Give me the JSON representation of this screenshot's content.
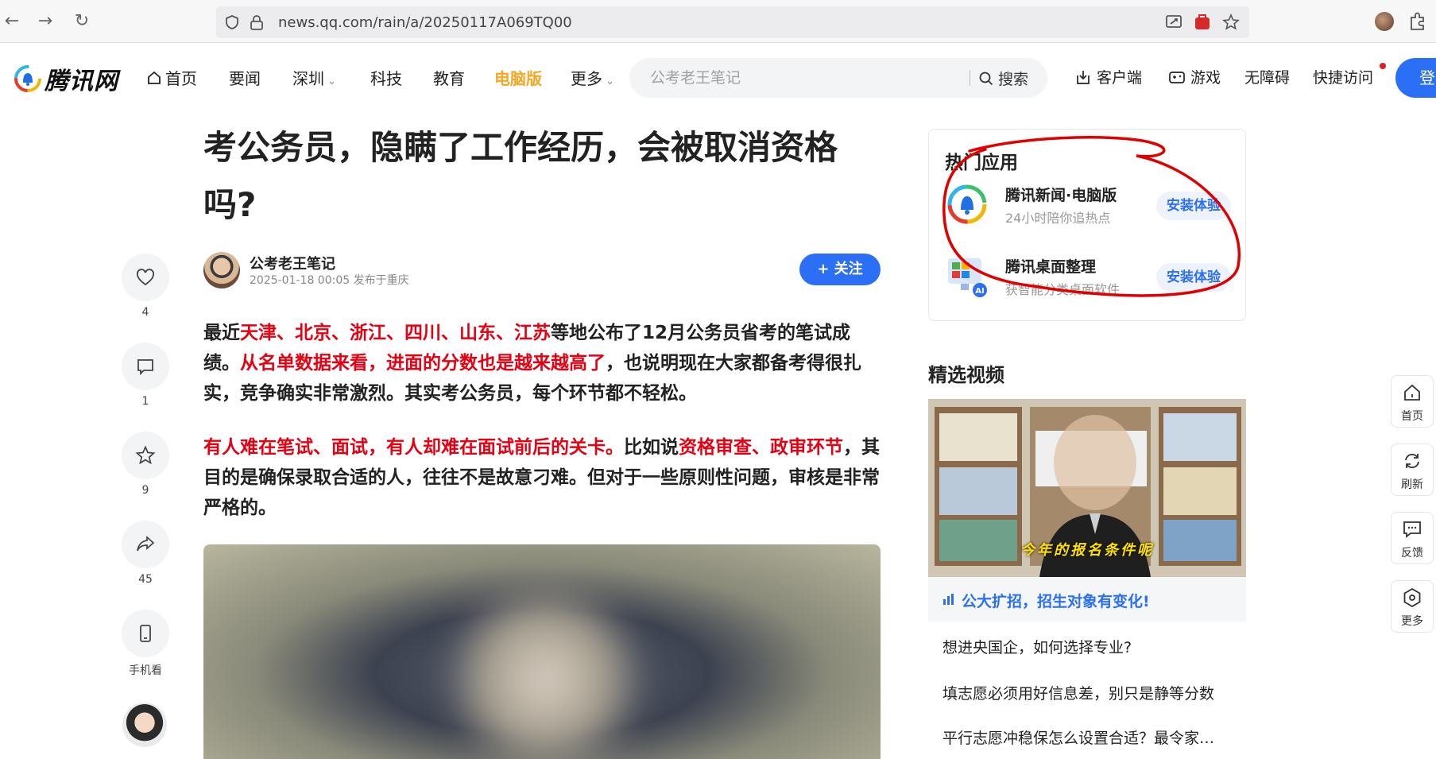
{
  "browser": {
    "url": "news.qq.com/rain/a/20250117A069TQ00"
  },
  "header": {
    "logo_text": "腾讯网",
    "nav": [
      "首页",
      "要闻",
      "深圳",
      "科技",
      "教育",
      "电脑版",
      "更多"
    ],
    "search_placeholder": "公考老王笔记",
    "search_label": "搜索",
    "right_nav": [
      "客户端",
      "游戏",
      "无障碍",
      "快捷访问"
    ],
    "login_label": "登"
  },
  "article": {
    "title": "考公务员，隐瞒了工作经历，会被取消资格吗?",
    "author": "公考老王笔记",
    "meta": "2025-01-18 00:05  发布于重庆",
    "follow_label": "+ 关注",
    "p1": [
      {
        "t": "最近",
        "red": false
      },
      {
        "t": "天津、北京、浙江、四川、山东、江苏",
        "red": true
      },
      {
        "t": "等地公布了12月公务员省考的笔试成绩。",
        "red": false
      },
      {
        "t": "从名单数据来看，进面的分数也是越来越高了",
        "red": true
      },
      {
        "t": "，也说明现在大家都备考得很扎实，竞争确实非常激烈。其实考公务员，每个环节都不轻松。",
        "red": false
      }
    ],
    "p2": [
      {
        "t": "有人难在笔试、面试，有人却难在面试前后的关卡。",
        "red": true
      },
      {
        "t": "比如说",
        "red": false
      },
      {
        "t": "资格审查、政审环节",
        "red": true
      },
      {
        "t": "，其目的是确保录取合适的人，往往不是故意刁难。但对于一些原则性问题，审核是非常严格的。",
        "red": false
      }
    ]
  },
  "actions": {
    "like_count": "4",
    "comment_count": "1",
    "favorite_count": "9",
    "share_count": "45",
    "mobile_label": "手机看"
  },
  "hot_apps": {
    "title": "热门应用",
    "apps": [
      {
        "name": "腾讯新闻·电脑版",
        "desc": "24小时陪你追热点",
        "button": "安装体验"
      },
      {
        "name": "腾讯桌面整理",
        "desc": "获智能分类桌面软件",
        "button": "安装体验"
      }
    ]
  },
  "videos": {
    "title": "精选视频",
    "overlay_text": "今年的报名条件呢",
    "featured": "公大扩招，招生对象有变化!",
    "items": [
      "想进央国企，如何选择专业?",
      "填志愿必须用好信息差，别只是静等分数",
      "平行志愿冲稳保怎么设置合适？最令家…"
    ]
  },
  "float_bar": [
    "首页",
    "刷新",
    "反馈",
    "更多"
  ],
  "colors": {
    "accent": "#2a6ff6",
    "highlight": "#e60012",
    "nav_highlight": "#f5a623"
  }
}
